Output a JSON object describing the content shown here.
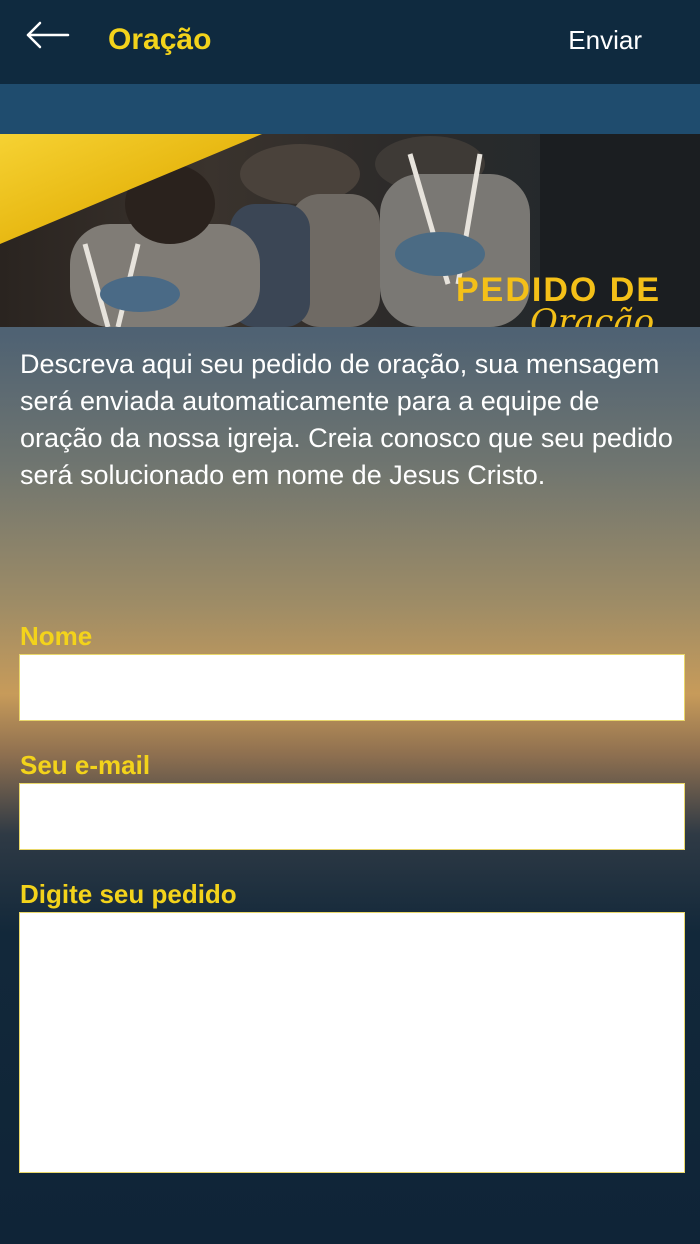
{
  "app_bar": {
    "title": "Oração",
    "send_label": "Enviar",
    "back_icon": "arrow-left-icon"
  },
  "banner": {
    "line1": "PEDIDO DE",
    "line2": "Oração"
  },
  "description": "Descreva aqui seu pedido de oração, sua mensagem será enviada automaticamente para a equipe de oração da nossa igreja. Creia conosco que seu pedido será solucionado em nome de Jesus Cristo.",
  "form": {
    "name_label": "Nome",
    "name_value": "",
    "email_label": "Seu e-mail",
    "email_value": "",
    "request_label": "Digite seu pedido",
    "request_value": ""
  },
  "colors": {
    "accent_yellow": "#f3d31b",
    "app_bar": "#0f2a3f",
    "sub_bar": "#1f4c6e"
  }
}
